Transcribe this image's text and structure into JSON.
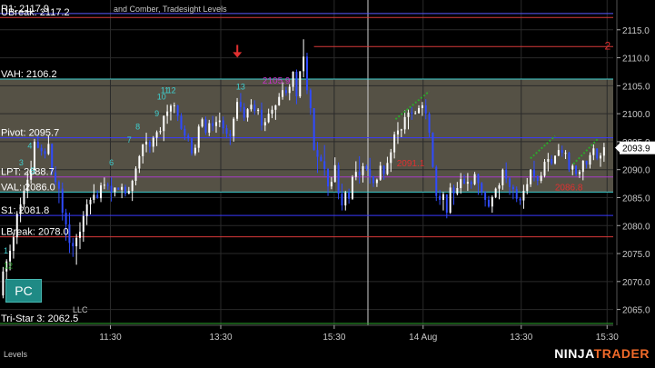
{
  "chart": {
    "subtitle_partial": "and Comber, Tradesight Levels",
    "footer_left": "Levels",
    "copyright_partial": "LLC",
    "brand_white": "NINJA",
    "brand_orange": "TRADER",
    "price_tag": "2093.9",
    "button_label": "PC"
  },
  "chart_data": {
    "type": "candlestick",
    "title": "",
    "y_range": [
      2062.5,
      2120
    ],
    "y_ticks": [
      2065.0,
      2070.0,
      2075.0,
      2080.0,
      2085.0,
      2090.0,
      2095.0,
      2100.0,
      2105.0,
      2110.0,
      2115.0
    ],
    "y_tick_labels": [
      "2065.0",
      "2070.0",
      "2075.0",
      "2080.0",
      "2085.0",
      "2090.0",
      "2095.0",
      "2100.0",
      "2105.0",
      "2110.0",
      "2115.0"
    ],
    "x_tick_labels": [
      "11:30",
      "13:30",
      "15:30",
      "14 Aug",
      "13:30",
      "15:30"
    ],
    "x_ticks": [
      0.18,
      0.36,
      0.545,
      0.69,
      0.85,
      0.99
    ],
    "session_break": 0.6,
    "last_price": 2093.9,
    "value_area": {
      "high": 2106.2,
      "low": 2086.0
    },
    "levels": [
      {
        "name": "R1",
        "label": "R1: 2117.9",
        "value": 2117.9,
        "color": "#5a5aff"
      },
      {
        "name": "UBreak",
        "label": "UBreak: 2117.2",
        "value": 2117.2,
        "color": "#d83a3a"
      },
      {
        "name": "VAH",
        "label": "VAH: 2106.2",
        "value": 2106.2,
        "color": "#3fd0d0"
      },
      {
        "name": "Pivot",
        "label": "Pivot: 2095.7",
        "value": 2095.7,
        "color": "#3a3aff"
      },
      {
        "name": "LPT",
        "label": "LPT: 2088.7",
        "value": 2088.7,
        "color": "#a83ac8"
      },
      {
        "name": "VAL",
        "label": "VAL: 2086.0",
        "value": 2086.0,
        "color": "#3fd0d0"
      },
      {
        "name": "S1",
        "label": "S1: 2081.8",
        "value": 2081.8,
        "color": "#3a3aff"
      },
      {
        "name": "LBreak",
        "label": "LBreak: 2078.0",
        "value": 2078.0,
        "color": "#d83a3a"
      },
      {
        "name": "TriStar",
        "label": "Tri-Star 3: 2062.5",
        "value": 2062.5,
        "color": "#2ca82c"
      }
    ],
    "candles": [
      [
        2067.5,
        2072.6,
        2067.0,
        2071.8
      ],
      [
        2071.8,
        2074.0,
        2070.0,
        2073.6
      ],
      [
        2073.6,
        2076.6,
        2072.0,
        2075.5
      ],
      [
        2075.5,
        2078.6,
        2074.1,
        2077.9
      ],
      [
        2077.9,
        2082.6,
        2076.7,
        2082.1
      ],
      [
        2082.1,
        2085.0,
        2080.6,
        2083.8
      ],
      [
        2083.8,
        2087.2,
        2083.2,
        2086.2
      ],
      [
        2086.2,
        2089.6,
        2084.9,
        2088.2
      ],
      [
        2088.2,
        2091.6,
        2087.5,
        2089.9
      ],
      [
        2089.9,
        2095.5,
        2089.2,
        2095.0
      ],
      [
        2095.0,
        2096.2,
        2093.8,
        2093.9
      ],
      [
        2093.9,
        2094.5,
        2092.5,
        2093.3
      ],
      [
        2093.3,
        2093.8,
        2092.0,
        2092.8
      ],
      [
        2092.8,
        2096.1,
        2092.6,
        2094.6
      ],
      [
        2094.6,
        2094.7,
        2089.0,
        2089.5
      ],
      [
        2089.5,
        2090.6,
        2087.2,
        2087.8
      ],
      [
        2087.8,
        2088.1,
        2084.0,
        2086.6
      ],
      [
        2086.6,
        2087.7,
        2080.9,
        2082.3
      ],
      [
        2082.3,
        2083.0,
        2077.3,
        2080.2
      ],
      [
        2080.2,
        2082.3,
        2075.1,
        2076.9
      ],
      [
        2076.9,
        2077.8,
        2074.4,
        2076.3
      ],
      [
        2076.3,
        2078.5,
        2073.0,
        2077.8
      ],
      [
        2077.8,
        2080.6,
        2075.8,
        2078.9
      ],
      [
        2078.9,
        2082.6,
        2077.1,
        2081.7
      ],
      [
        2081.7,
        2084.7,
        2080.1,
        2083.8
      ],
      [
        2083.8,
        2085.0,
        2082.0,
        2084.6
      ],
      [
        2084.6,
        2087.4,
        2084.0,
        2085.5
      ],
      [
        2085.5,
        2086.3,
        2084.8,
        2084.9
      ],
      [
        2084.9,
        2087.7,
        2084.2,
        2087.2
      ],
      [
        2087.2,
        2088.6,
        2086.5,
        2087.3
      ],
      [
        2087.3,
        2087.7,
        2086.4,
        2087.1
      ],
      [
        2087.1,
        2088.6,
        2084.3,
        2086.0
      ],
      [
        2086.0,
        2086.8,
        2085.2,
        2086.8
      ],
      [
        2086.8,
        2086.8,
        2086.4,
        2086.4
      ],
      [
        2086.4,
        2087.5,
        2084.9,
        2086.9
      ],
      [
        2086.9,
        2087.3,
        2085.2,
        2085.7
      ],
      [
        2085.7,
        2086.9,
        2085.6,
        2086.2
      ],
      [
        2086.2,
        2088.2,
        2084.4,
        2088.0
      ],
      [
        2088.0,
        2090.6,
        2087.2,
        2090.2
      ],
      [
        2090.2,
        2092.6,
        2089.4,
        2092.4
      ],
      [
        2092.4,
        2094.6,
        2091.1,
        2094.5
      ],
      [
        2094.5,
        2096.6,
        2093.1,
        2095.0
      ],
      [
        2095.0,
        2095.3,
        2093.0,
        2094.1
      ],
      [
        2094.1,
        2096.0,
        2093.1,
        2095.7
      ],
      [
        2095.7,
        2097.0,
        2094.2,
        2096.7
      ],
      [
        2096.7,
        2097.6,
        2096.3,
        2096.9
      ],
      [
        2096.9,
        2099.7,
        2095.1,
        2099.6
      ],
      [
        2099.6,
        2101.6,
        2098.2,
        2100.4
      ],
      [
        2100.4,
        2101.7,
        2098.8,
        2101.4
      ],
      [
        2101.4,
        2102.0,
        2100.1,
        2101.5
      ],
      [
        2101.5,
        2101.6,
        2098.7,
        2099.6
      ],
      [
        2099.6,
        2100.1,
        2097.1,
        2097.3
      ],
      [
        2097.3,
        2097.9,
        2095.3,
        2096.1
      ],
      [
        2096.1,
        2096.5,
        2095.0,
        2095.6
      ],
      [
        2095.6,
        2095.7,
        2092.5,
        2092.9
      ],
      [
        2092.9,
        2094.5,
        2092.5,
        2093.9
      ],
      [
        2093.9,
        2098.1,
        2093.1,
        2097.7
      ],
      [
        2097.7,
        2099.3,
        2097.5,
        2099.0
      ],
      [
        2099.0,
        2099.5,
        2096.2,
        2096.6
      ],
      [
        2096.6,
        2098.9,
        2096.0,
        2098.3
      ],
      [
        2098.3,
        2099.6,
        2096.9,
        2097.8
      ],
      [
        2097.8,
        2099.5,
        2096.6,
        2098.5
      ],
      [
        2098.5,
        2100.2,
        2097.6,
        2098.8
      ],
      [
        2098.8,
        2099.5,
        2096.4,
        2097.4
      ],
      [
        2097.4,
        2098.0,
        2095.6,
        2096.4
      ],
      [
        2096.4,
        2097.1,
        2094.4,
        2096.0
      ],
      [
        2096.0,
        2099.4,
        2095.0,
        2099.1
      ],
      [
        2099.1,
        2102.8,
        2098.7,
        2102.1
      ],
      [
        2102.1,
        2103.7,
        2100.4,
        2101.2
      ],
      [
        2101.2,
        2101.9,
        2098.7,
        2099.3
      ],
      [
        2099.3,
        2101.0,
        2098.6,
        2100.8
      ],
      [
        2100.8,
        2102.6,
        2100.4,
        2101.6
      ],
      [
        2101.6,
        2102.4,
        2099.8,
        2100.5
      ],
      [
        2100.5,
        2101.0,
        2099.8,
        2100.7
      ],
      [
        2100.7,
        2102.0,
        2097.0,
        2097.9
      ],
      [
        2097.9,
        2099.2,
        2096.9,
        2098.5
      ],
      [
        2098.5,
        2100.9,
        2098.3,
        2100.0
      ],
      [
        2100.0,
        2101.4,
        2099.2,
        2100.7
      ],
      [
        2100.7,
        2101.6,
        2098.9,
        2101.5
      ],
      [
        2101.5,
        2103.7,
        2101.4,
        2103.0
      ],
      [
        2103.0,
        2105.6,
        2102.5,
        2104.2
      ],
      [
        2104.2,
        2104.8,
        2103.2,
        2103.7
      ],
      [
        2103.7,
        2105.3,
        2102.4,
        2104.8
      ],
      [
        2104.8,
        2107.6,
        2104.1,
        2107.5
      ],
      [
        2107.5,
        2107.9,
        2101.7,
        2103.1
      ],
      [
        2103.1,
        2107.6,
        2102.8,
        2107.6
      ],
      [
        2107.6,
        2113.3,
        2106.5,
        2110.2
      ],
      [
        2110.2,
        2110.9,
        2103.5,
        2104.2
      ],
      [
        2104.2,
        2104.5,
        2099.8,
        2101.0
      ],
      [
        2101.0,
        2101.0,
        2093.4,
        2093.5
      ],
      [
        2093.5,
        2095.0,
        2089.4,
        2092.3
      ],
      [
        2092.3,
        2092.7,
        2091.5,
        2091.5
      ],
      [
        2091.5,
        2094.4,
        2088.9,
        2090.1
      ],
      [
        2090.1,
        2090.3,
        2085.3,
        2087.0
      ],
      [
        2087.0,
        2088.7,
        2086.5,
        2087.8
      ],
      [
        2087.8,
        2092.2,
        2087.7,
        2090.8
      ],
      [
        2090.8,
        2091.3,
        2084.7,
        2085.7
      ],
      [
        2085.7,
        2087.5,
        2082.7,
        2083.6
      ],
      [
        2083.6,
        2086.2,
        2082.7,
        2085.9
      ],
      [
        2085.9,
        2086.6,
        2083.9,
        2084.8
      ],
      [
        2084.8,
        2089.0,
        2084.6,
        2088.7
      ],
      [
        2088.7,
        2091.5,
        2088.1,
        2089.6
      ],
      [
        2089.6,
        2092.4,
        2087.5,
        2089.0
      ],
      [
        2089.0,
        2091.2,
        2087.7,
        2090.6
      ],
      [
        2090.6,
        2090.9,
        2089.8,
        2090.1
      ],
      [
        2090.1,
        2092.1,
        2087.5,
        2088.8
      ],
      [
        2088.8,
        2088.9,
        2086.9,
        2087.6
      ],
      [
        2087.6,
        2088.4,
        2086.9,
        2088.2
      ],
      [
        2088.2,
        2091.4,
        2088.0,
        2090.7
      ],
      [
        2090.7,
        2090.8,
        2088.2,
        2089.2
      ],
      [
        2089.2,
        2092.3,
        2089.0,
        2091.2
      ],
      [
        2091.2,
        2093.7,
        2089.6,
        2093.1
      ],
      [
        2093.1,
        2096.8,
        2092.0,
        2096.3
      ],
      [
        2096.3,
        2098.5,
        2094.6,
        2097.0
      ],
      [
        2097.0,
        2097.3,
        2095.8,
        2097.2
      ],
      [
        2097.2,
        2100.6,
        2096.4,
        2099.4
      ],
      [
        2099.4,
        2100.8,
        2097.2,
        2100.2
      ],
      [
        2100.2,
        2101.2,
        2098.9,
        2100.0
      ],
      [
        2100.0,
        2100.5,
        2099.9,
        2100.1
      ],
      [
        2100.1,
        2101.5,
        2100.0,
        2101.0
      ],
      [
        2101.0,
        2102.1,
        2099.6,
        2101.5
      ],
      [
        2101.5,
        2102.6,
        2099.0,
        2100.0
      ],
      [
        2100.0,
        2100.3,
        2095.8,
        2096.6
      ],
      [
        2096.6,
        2096.7,
        2090.3,
        2090.5
      ],
      [
        2090.5,
        2090.8,
        2084.4,
        2085.3
      ],
      [
        2085.3,
        2086.4,
        2083.7,
        2084.6
      ],
      [
        2084.6,
        2086.0,
        2082.7,
        2085.6
      ],
      [
        2085.6,
        2085.6,
        2081.3,
        2082.3
      ],
      [
        2082.3,
        2087.6,
        2082.1,
        2086.8
      ],
      [
        2086.8,
        2087.3,
        2083.7,
        2085.7
      ],
      [
        2085.7,
        2087.8,
        2085.4,
        2086.7
      ],
      [
        2086.7,
        2089.4,
        2085.7,
        2088.3
      ],
      [
        2088.3,
        2089.1,
        2087.4,
        2087.5
      ],
      [
        2087.5,
        2089.4,
        2086.2,
        2087.8
      ],
      [
        2087.8,
        2088.1,
        2086.6,
        2087.4
      ],
      [
        2087.4,
        2089.6,
        2087.2,
        2089.2
      ],
      [
        2089.2,
        2089.3,
        2085.5,
        2087.6
      ],
      [
        2087.6,
        2087.8,
        2085.4,
        2086.0
      ],
      [
        2086.0,
        2086.2,
        2083.4,
        2084.6
      ],
      [
        2084.6,
        2085.3,
        2083.2,
        2083.4
      ],
      [
        2083.4,
        2085.4,
        2082.3,
        2085.1
      ],
      [
        2085.1,
        2086.8,
        2084.9,
        2086.6
      ],
      [
        2086.6,
        2087.6,
        2084.7,
        2087.2
      ],
      [
        2087.2,
        2090.2,
        2086.4,
        2090.0
      ],
      [
        2090.0,
        2091.3,
        2087.6,
        2088.4
      ],
      [
        2088.4,
        2088.7,
        2085.5,
        2086.9
      ],
      [
        2086.9,
        2087.3,
        2084.7,
        2086.5
      ],
      [
        2086.5,
        2087.0,
        2084.2,
        2084.8
      ],
      [
        2084.8,
        2085.1,
        2083.7,
        2084.5
      ],
      [
        2084.5,
        2087.3,
        2083.0,
        2086.2
      ],
      [
        2086.2,
        2088.5,
        2085.6,
        2087.4
      ],
      [
        2087.4,
        2090.1,
        2086.9,
        2090.0
      ],
      [
        2090.0,
        2091.6,
        2087.9,
        2088.8
      ],
      [
        2088.8,
        2089.0,
        2087.2,
        2088.0
      ],
      [
        2088.0,
        2089.6,
        2087.6,
        2088.9
      ],
      [
        2088.9,
        2091.9,
        2088.6,
        2091.4
      ],
      [
        2091.4,
        2093.0,
        2089.7,
        2091.9
      ],
      [
        2091.9,
        2092.6,
        2090.8,
        2091.1
      ],
      [
        2091.1,
        2092.5,
        2090.9,
        2092.5
      ],
      [
        2092.5,
        2094.6,
        2092.4,
        2093.5
      ],
      [
        2093.5,
        2094.3,
        2092.3,
        2093.0
      ],
      [
        2093.0,
        2093.5,
        2091.9,
        2093.0
      ],
      [
        2093.0,
        2093.2,
        2089.6,
        2090.0
      ],
      [
        2090.0,
        2091.0,
        2089.0,
        2090.7
      ],
      [
        2090.7,
        2090.8,
        2088.8,
        2089.2
      ],
      [
        2089.2,
        2090.0,
        2088.5,
        2089.6
      ],
      [
        2089.6,
        2091.7,
        2088.1,
        2091.6
      ],
      [
        2091.6,
        2091.6,
        2090.2,
        2090.9
      ],
      [
        2090.9,
        2093.1,
        2090.2,
        2092.6
      ],
      [
        2092.6,
        2094.5,
        2091.7,
        2093.8
      ],
      [
        2093.8,
        2093.8,
        2091.7,
        2092.0
      ],
      [
        2092.0,
        2093.0,
        2090.5,
        2092.5
      ],
      [
        2092.5,
        2094.8,
        2091.4,
        2094.0
      ]
    ],
    "annotations": [
      {
        "text": "2105.9",
        "value": 2105.9,
        "at": 0.428,
        "color": "#c832c8"
      },
      {
        "text": "2091.1",
        "value": 2091.1,
        "at": 0.647,
        "color": "#e03030"
      },
      {
        "text": "2086.8",
        "value": 2086.8,
        "at": 0.905,
        "color": "#e03030"
      },
      {
        "text": "2",
        "value": 2112.0,
        "at": 0.986,
        "color": "#e03030"
      }
    ],
    "sequence_labels": [
      {
        "text": "1",
        "value": 2075.0,
        "at": 0.006,
        "color": "#3fd0d0"
      },
      {
        "text": "12",
        "value": 2072.3,
        "at": 0.006,
        "color": "#2ca82c"
      },
      {
        "text": "3",
        "value": 2090.8,
        "at": 0.031,
        "color": "#3fd0d0"
      },
      {
        "text": "4",
        "value": 2093.8,
        "at": 0.045,
        "color": "#3fd0d0"
      },
      {
        "text": "5",
        "value": 2089.3,
        "at": 0.05,
        "color": "#3fd0d0"
      },
      {
        "text": "6",
        "value": 2090.8,
        "at": 0.178,
        "color": "#3fd0d0"
      },
      {
        "text": "7",
        "value": 2094.8,
        "at": 0.207,
        "color": "#3fd0d0"
      },
      {
        "text": "8",
        "value": 2097.2,
        "at": 0.221,
        "color": "#3fd0d0"
      },
      {
        "text": "9",
        "value": 2099.5,
        "at": 0.252,
        "color": "#3fd0d0"
      },
      {
        "text": "10",
        "value": 2102.5,
        "at": 0.256,
        "color": "#3fd0d0"
      },
      {
        "text": "11",
        "value": 2103.7,
        "at": 0.262,
        "color": "#3fd0d0"
      },
      {
        "text": "12",
        "value": 2103.7,
        "at": 0.272,
        "color": "#3fd0d0"
      },
      {
        "text": "13",
        "value": 2104.3,
        "at": 0.385,
        "color": "#3fd0d0"
      }
    ],
    "arrow": {
      "value": 2111.0,
      "at": 0.387,
      "color": "#e03030"
    }
  }
}
